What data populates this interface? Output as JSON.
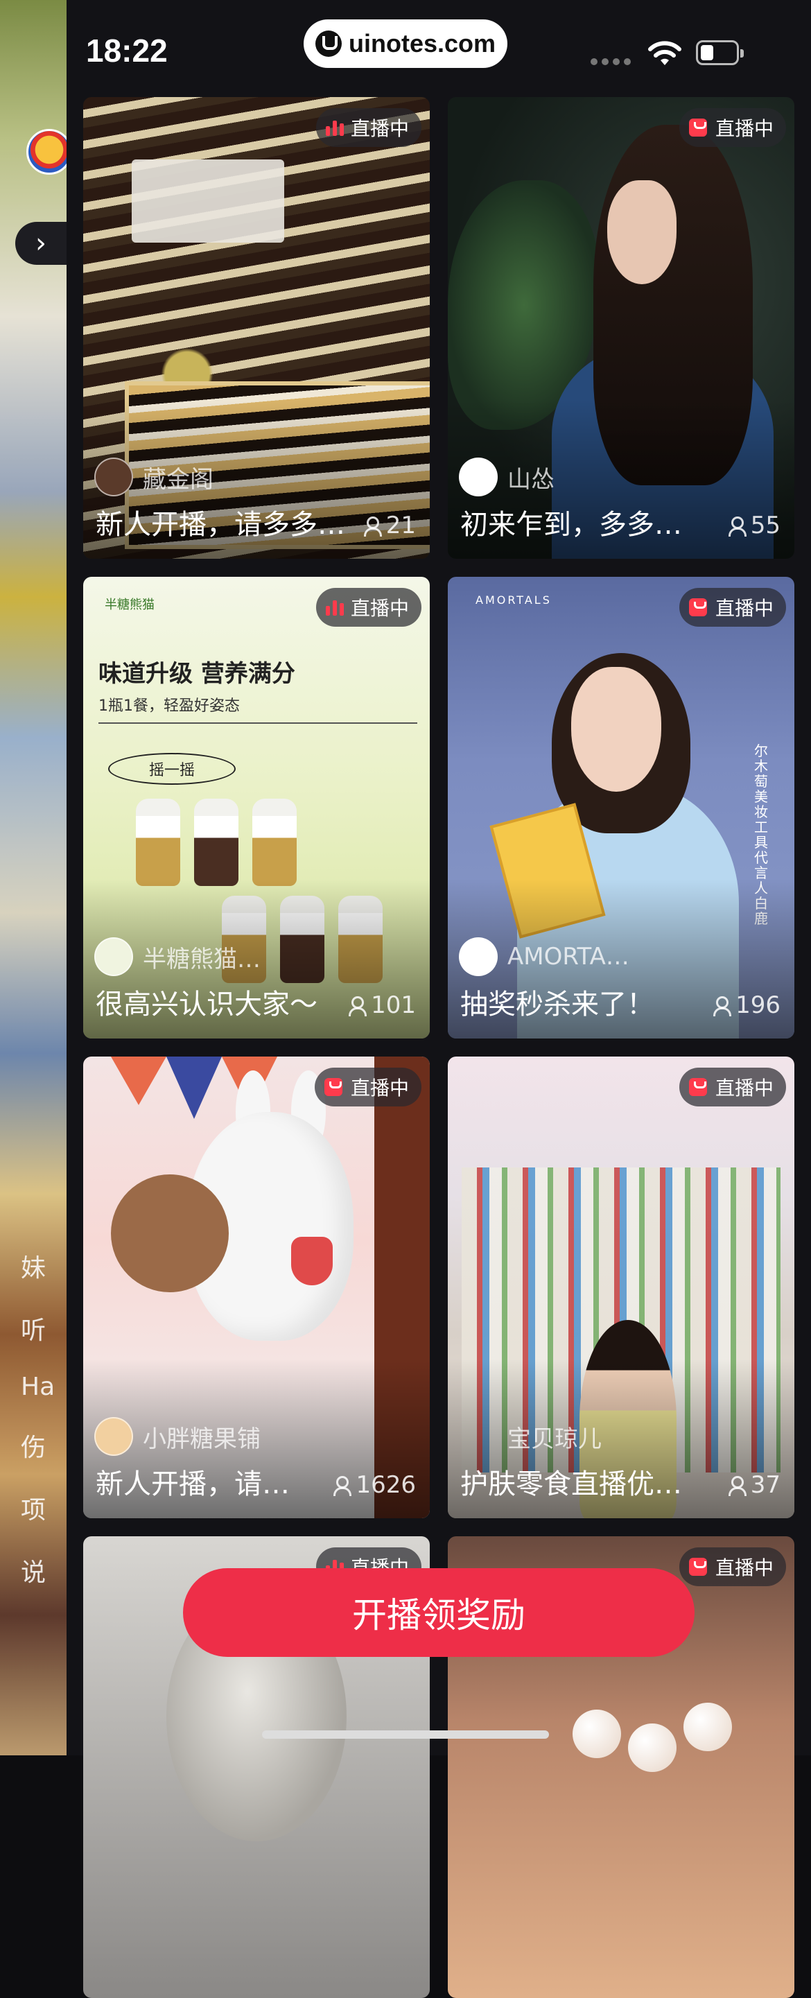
{
  "status_bar": {
    "time": "18:22",
    "url": "uinotes.com"
  },
  "side_panel": {
    "texts": [
      "妹",
      "听",
      "Ha",
      "伤",
      "项",
      "说"
    ]
  },
  "live_badge": "直播中",
  "cards": [
    {
      "streamer": "藏金阁",
      "title": "新人开播，请多多…",
      "viewers": "21"
    },
    {
      "streamer": "山怂",
      "title": "初来乍到，多多…",
      "viewers": "55"
    },
    {
      "streamer": "半糖熊猫…",
      "title": "很高兴认识大家～",
      "viewers": "101",
      "image_text": {
        "brand": "半糖熊猫",
        "heading": "味道升级  营养满分",
        "sub": "1瓶1餐，轻盈好姿态",
        "oval": "摇一摇"
      }
    },
    {
      "streamer": "AMORTA…",
      "title": "抽奖秒杀来了！",
      "viewers": "196",
      "image_text": {
        "logo": "AMORTALS",
        "vertical": "尔木萄美妆工具代言人 白鹿"
      }
    },
    {
      "streamer": "小胖糖果铺",
      "title": "新人开播，请…",
      "viewers": "1626"
    },
    {
      "streamer": "宝贝琼儿",
      "title": "护肤零食直播优…",
      "viewers": "37"
    },
    {
      "streamer": "",
      "title": "",
      "viewers": ""
    },
    {
      "streamer": "",
      "title": "",
      "viewers": ""
    }
  ],
  "start_button": "开播领奖励",
  "colors": {
    "accent": "#ee2e48",
    "background": "#121216"
  }
}
